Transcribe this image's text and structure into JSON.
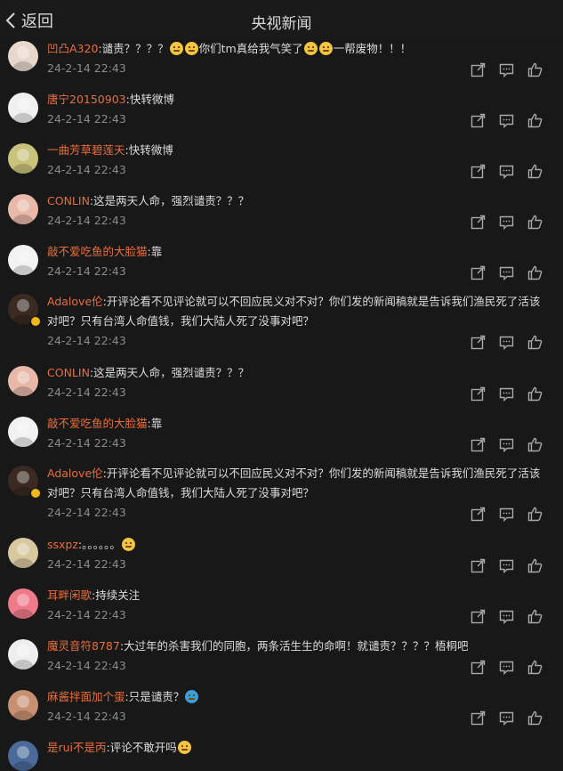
{
  "header": {
    "back_label": "返回",
    "title": "央视新闻"
  },
  "comments": [
    {
      "user": "凹凸A320",
      "text": ":谴责？？？？",
      "text_after_emoji": "你们tm真给我气笑了",
      "text_end": "一帮废物！！！",
      "time": "24-2-14 22:43",
      "avatar_color": "#e8d8cc"
    },
    {
      "user": "唐宁20150903",
      "text": ":快转微博",
      "time": "24-2-14 22:43",
      "avatar_color": "#f0f0f0"
    },
    {
      "user": "一曲芳草碧莲天",
      "text": ":快转微博",
      "time": "24-2-14 22:43",
      "avatar_color": "#c9c27a"
    },
    {
      "user": "CONLIN",
      "text": ":这是两天人命，强烈谴责？？？",
      "time": "24-2-14 22:43",
      "avatar_color": "#e8b8a8"
    },
    {
      "user": "敲不爱吃鱼的大脸猫",
      "text": ":靠",
      "time": "24-2-14 22:43",
      "avatar_color": "#f2f2f2"
    },
    {
      "user": "Adalove伦",
      "text": ":开评论看不见评论就可以不回应民义对不对？你们发的新闻稿就是告诉我们渔民死了活该对吧？只有台湾人命值钱，我们大陆人死了没事对吧？",
      "time": "24-2-14 22:43",
      "avatar_color": "#3a2a22"
    },
    {
      "user": "CONLIN",
      "text": ":这是两天人命，强烈谴责？？？",
      "time": "24-2-14 22:43",
      "avatar_color": "#e8b8a8"
    },
    {
      "user": "敲不爱吃鱼的大脸猫",
      "text": ":靠",
      "time": "24-2-14 22:43",
      "avatar_color": "#f2f2f2"
    },
    {
      "user": "Adalove伦",
      "text": ":开评论看不见评论就可以不回应民义对不对？你们发的新闻稿就是告诉我们渔民死了活该对吧？只有台湾人命值钱，我们大陆人死了没事对吧？",
      "time": "24-2-14 22:43",
      "avatar_color": "#3a2a22"
    },
    {
      "user": "ssxpz",
      "text": ":。。。。。。",
      "time": "24-2-14 22:43",
      "avatar_color": "#d8c8a0"
    },
    {
      "user": "耳畔闲歌",
      "text": ":持续关注",
      "time": "24-2-14 22:43",
      "avatar_color": "#ef7a8a"
    },
    {
      "user": "魔灵音符8787",
      "text": ":大过年的杀害我们的同胞，两条活生生的命啊！就谴责？？？？梧桐吧",
      "time": "24-2-14 22:43",
      "avatar_color": "#eeeeee"
    },
    {
      "user": "麻酱拌面加个蛋",
      "text": ":只是谴责？",
      "time": "24-2-14 22:43",
      "avatar_color": "#c89070"
    },
    {
      "user": "是rui不是丙",
      "text": ":评论不敢开吗",
      "time": "",
      "avatar_color": "#4a6a9a"
    }
  ],
  "icons": {
    "repost": "repost-icon",
    "comment": "comment-icon",
    "like": "like-icon"
  }
}
